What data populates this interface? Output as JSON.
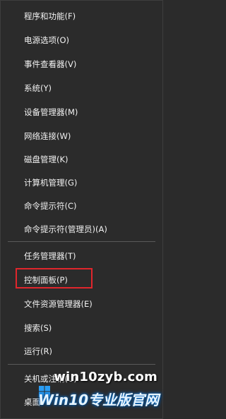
{
  "menu": {
    "group1": [
      {
        "label": "程序和功能(F)"
      },
      {
        "label": "电源选项(O)"
      },
      {
        "label": "事件查看器(V)"
      },
      {
        "label": "系统(Y)"
      },
      {
        "label": "设备管理器(M)"
      },
      {
        "label": "网络连接(W)"
      },
      {
        "label": "磁盘管理(K)"
      },
      {
        "label": "计算机管理(G)"
      },
      {
        "label": "命令提示符(C)"
      },
      {
        "label": "命令提示符(管理员)(A)"
      }
    ],
    "group2": [
      {
        "label": "任务管理器(T)"
      },
      {
        "label": "控制面板(P)"
      },
      {
        "label": "文件资源管理器(E)"
      },
      {
        "label": "搜索(S)"
      },
      {
        "label": "运行(R)"
      }
    ],
    "group3": [
      {
        "label": "关机或注销(U)"
      },
      {
        "label": "桌面"
      }
    ]
  },
  "watermark": {
    "url": "win10zyb.com",
    "brand": "Win10专业版官网"
  },
  "colors": {
    "background": "#2b2b2b",
    "text": "#f2f2f2",
    "separator": "#5a5a5a",
    "highlight_border": "#e0262c"
  }
}
